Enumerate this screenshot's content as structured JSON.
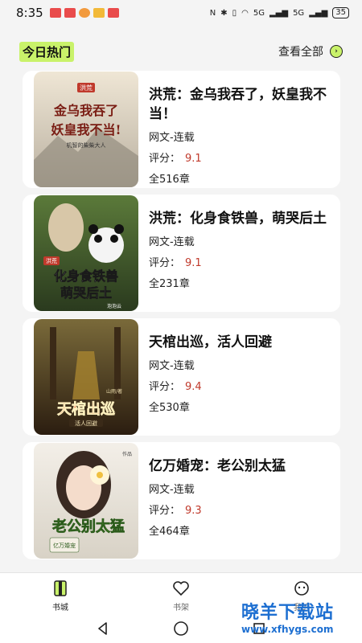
{
  "status_bar": {
    "time": "8:35",
    "signal_left": "5G",
    "signal_right": "5G",
    "battery": "35"
  },
  "section": {
    "title": "今日热门",
    "view_all": "查看全部"
  },
  "books": [
    {
      "cover_text": "洪荒",
      "cover_title": "金乌我吞了，妖皇我不当！",
      "cover_author": "机智的柴柴大人",
      "title": "洪荒：金乌我吞了，妖皇我不当！",
      "category": "网文-连载",
      "score_label": "评分：",
      "score": "9.1",
      "chapters": "全516章"
    },
    {
      "cover_text": "洪荒",
      "cover_title": "化身食铁兽 萌哭后土",
      "cover_author": "泡泡云",
      "title": "洪荒：化身食铁兽，萌哭后土",
      "category": "网文-连载",
      "score_label": "评分：",
      "score": "9.1",
      "chapters": "全231章"
    },
    {
      "cover_text": "山雨/著",
      "cover_title": "天棺出巡",
      "cover_subtitle": "活人回避",
      "title": "天棺出巡，活人回避",
      "category": "网文-连载",
      "score_label": "评分：",
      "score": "9.4",
      "chapters": "全530章"
    },
    {
      "cover_text": "作品",
      "cover_title": "老公别太猛",
      "cover_subtitle": "亿万婚宠",
      "title": "亿万婚宠：老公别太猛",
      "category": "网文-连载",
      "score_label": "评分：",
      "score": "9.3",
      "chapters": "全464章"
    }
  ],
  "tabs": [
    {
      "label": "书城",
      "icon": "book-city-icon"
    },
    {
      "label": "书架",
      "icon": "heart-icon"
    },
    {
      "label": "我的",
      "icon": "profile-icon"
    }
  ],
  "watermark": {
    "main": "晓羊下载站",
    "url": "www.xfhygs.com"
  },
  "colors": {
    "accent": "#c9f26a",
    "score": "#c0392b"
  }
}
